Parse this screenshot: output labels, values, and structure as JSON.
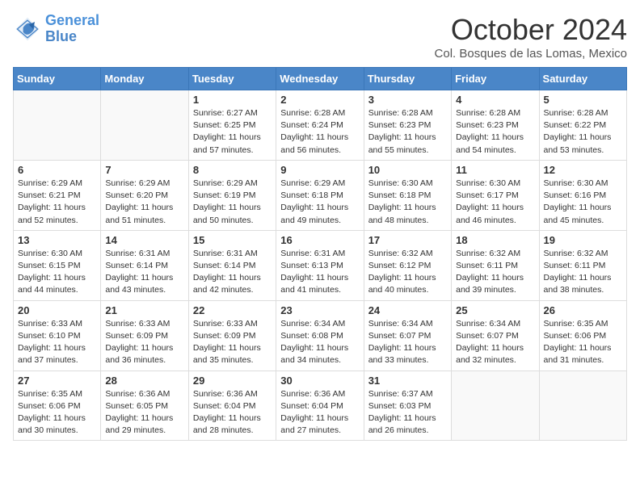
{
  "header": {
    "logo_line1": "General",
    "logo_line2": "Blue",
    "month": "October 2024",
    "location": "Col. Bosques de las Lomas, Mexico"
  },
  "weekdays": [
    "Sunday",
    "Monday",
    "Tuesday",
    "Wednesday",
    "Thursday",
    "Friday",
    "Saturday"
  ],
  "weeks": [
    [
      {
        "day": "",
        "info": ""
      },
      {
        "day": "",
        "info": ""
      },
      {
        "day": "1",
        "info": "Sunrise: 6:27 AM\nSunset: 6:25 PM\nDaylight: 11 hours and 57 minutes."
      },
      {
        "day": "2",
        "info": "Sunrise: 6:28 AM\nSunset: 6:24 PM\nDaylight: 11 hours and 56 minutes."
      },
      {
        "day": "3",
        "info": "Sunrise: 6:28 AM\nSunset: 6:23 PM\nDaylight: 11 hours and 55 minutes."
      },
      {
        "day": "4",
        "info": "Sunrise: 6:28 AM\nSunset: 6:23 PM\nDaylight: 11 hours and 54 minutes."
      },
      {
        "day": "5",
        "info": "Sunrise: 6:28 AM\nSunset: 6:22 PM\nDaylight: 11 hours and 53 minutes."
      }
    ],
    [
      {
        "day": "6",
        "info": "Sunrise: 6:29 AM\nSunset: 6:21 PM\nDaylight: 11 hours and 52 minutes."
      },
      {
        "day": "7",
        "info": "Sunrise: 6:29 AM\nSunset: 6:20 PM\nDaylight: 11 hours and 51 minutes."
      },
      {
        "day": "8",
        "info": "Sunrise: 6:29 AM\nSunset: 6:19 PM\nDaylight: 11 hours and 50 minutes."
      },
      {
        "day": "9",
        "info": "Sunrise: 6:29 AM\nSunset: 6:18 PM\nDaylight: 11 hours and 49 minutes."
      },
      {
        "day": "10",
        "info": "Sunrise: 6:30 AM\nSunset: 6:18 PM\nDaylight: 11 hours and 48 minutes."
      },
      {
        "day": "11",
        "info": "Sunrise: 6:30 AM\nSunset: 6:17 PM\nDaylight: 11 hours and 46 minutes."
      },
      {
        "day": "12",
        "info": "Sunrise: 6:30 AM\nSunset: 6:16 PM\nDaylight: 11 hours and 45 minutes."
      }
    ],
    [
      {
        "day": "13",
        "info": "Sunrise: 6:30 AM\nSunset: 6:15 PM\nDaylight: 11 hours and 44 minutes."
      },
      {
        "day": "14",
        "info": "Sunrise: 6:31 AM\nSunset: 6:14 PM\nDaylight: 11 hours and 43 minutes."
      },
      {
        "day": "15",
        "info": "Sunrise: 6:31 AM\nSunset: 6:14 PM\nDaylight: 11 hours and 42 minutes."
      },
      {
        "day": "16",
        "info": "Sunrise: 6:31 AM\nSunset: 6:13 PM\nDaylight: 11 hours and 41 minutes."
      },
      {
        "day": "17",
        "info": "Sunrise: 6:32 AM\nSunset: 6:12 PM\nDaylight: 11 hours and 40 minutes."
      },
      {
        "day": "18",
        "info": "Sunrise: 6:32 AM\nSunset: 6:11 PM\nDaylight: 11 hours and 39 minutes."
      },
      {
        "day": "19",
        "info": "Sunrise: 6:32 AM\nSunset: 6:11 PM\nDaylight: 11 hours and 38 minutes."
      }
    ],
    [
      {
        "day": "20",
        "info": "Sunrise: 6:33 AM\nSunset: 6:10 PM\nDaylight: 11 hours and 37 minutes."
      },
      {
        "day": "21",
        "info": "Sunrise: 6:33 AM\nSunset: 6:09 PM\nDaylight: 11 hours and 36 minutes."
      },
      {
        "day": "22",
        "info": "Sunrise: 6:33 AM\nSunset: 6:09 PM\nDaylight: 11 hours and 35 minutes."
      },
      {
        "day": "23",
        "info": "Sunrise: 6:34 AM\nSunset: 6:08 PM\nDaylight: 11 hours and 34 minutes."
      },
      {
        "day": "24",
        "info": "Sunrise: 6:34 AM\nSunset: 6:07 PM\nDaylight: 11 hours and 33 minutes."
      },
      {
        "day": "25",
        "info": "Sunrise: 6:34 AM\nSunset: 6:07 PM\nDaylight: 11 hours and 32 minutes."
      },
      {
        "day": "26",
        "info": "Sunrise: 6:35 AM\nSunset: 6:06 PM\nDaylight: 11 hours and 31 minutes."
      }
    ],
    [
      {
        "day": "27",
        "info": "Sunrise: 6:35 AM\nSunset: 6:06 PM\nDaylight: 11 hours and 30 minutes."
      },
      {
        "day": "28",
        "info": "Sunrise: 6:36 AM\nSunset: 6:05 PM\nDaylight: 11 hours and 29 minutes."
      },
      {
        "day": "29",
        "info": "Sunrise: 6:36 AM\nSunset: 6:04 PM\nDaylight: 11 hours and 28 minutes."
      },
      {
        "day": "30",
        "info": "Sunrise: 6:36 AM\nSunset: 6:04 PM\nDaylight: 11 hours and 27 minutes."
      },
      {
        "day": "31",
        "info": "Sunrise: 6:37 AM\nSunset: 6:03 PM\nDaylight: 11 hours and 26 minutes."
      },
      {
        "day": "",
        "info": ""
      },
      {
        "day": "",
        "info": ""
      }
    ]
  ]
}
